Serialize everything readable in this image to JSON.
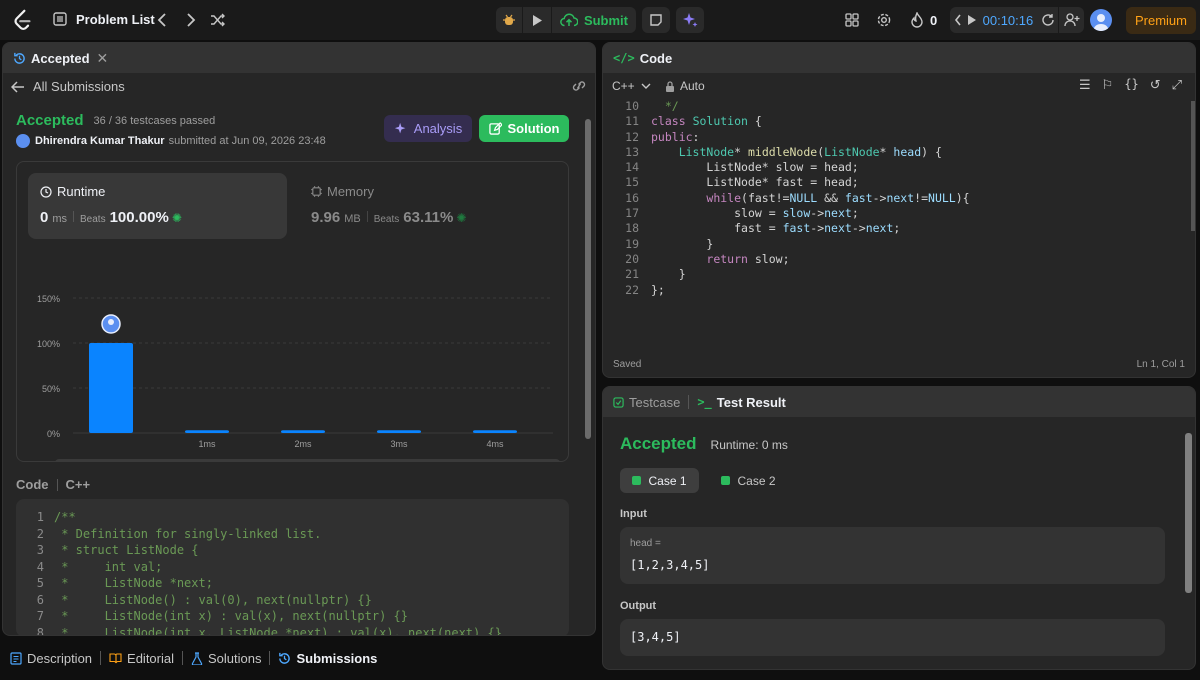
{
  "topbar": {
    "problem_list": "Problem List",
    "submit": "Submit",
    "streak": "0",
    "timer": "00:10:16",
    "premium": "Premium"
  },
  "left_panel": {
    "tab_title": "Accepted",
    "back_label": "All Submissions",
    "status": "Accepted",
    "testcases": "36 / 36 testcases passed",
    "user": "Dhirendra Kumar Thakur",
    "submitted_at": "submitted at Jun 09, 2026 23:48",
    "analysis_label": "Analysis",
    "solution_label": "Solution",
    "runtime": {
      "label": "Runtime",
      "value": "0",
      "unit": "ms",
      "beats_label": "Beats",
      "beats": "100.00%"
    },
    "memory": {
      "label": "Memory",
      "value": "9.96",
      "unit": "MB",
      "beats_label": "Beats",
      "beats": "63.11%"
    },
    "code_label": "Code",
    "code_lang": "C++",
    "code_lines": [
      {
        "n": "1",
        "t": "/**"
      },
      {
        "n": "2",
        "t": " * Definition for singly-linked list."
      },
      {
        "n": "3",
        "t": " * struct ListNode {"
      },
      {
        "n": "4",
        "t": " *     int val;"
      },
      {
        "n": "5",
        "t": " *     ListNode *next;"
      },
      {
        "n": "6",
        "t": " *     ListNode() : val(0), next(nullptr) {}"
      },
      {
        "n": "7",
        "t": " *     ListNode(int x) : val(x), next(nullptr) {}"
      },
      {
        "n": "8",
        "t": " *     ListNode(int x, ListNode *next) : val(x), next(next) {}"
      }
    ]
  },
  "chart_data": {
    "type": "bar",
    "categories": [
      "",
      "1ms",
      "2ms",
      "3ms",
      "4ms"
    ],
    "values": [
      100,
      3,
      3,
      3,
      3
    ],
    "ylim": [
      0,
      150
    ],
    "yticks": [
      "150%",
      "100%",
      "50%",
      "0%"
    ],
    "minimap_labels": [
      "1ms",
      "2ms",
      "3ms",
      "4ms"
    ],
    "bar_color": "#0a84ff"
  },
  "bottom_tabs": {
    "description": "Description",
    "editorial": "Editorial",
    "solutions": "Solutions",
    "submissions": "Submissions"
  },
  "editor": {
    "title": "Code",
    "lang": "C++",
    "mode": "Auto",
    "saved": "Saved",
    "position": "Ln 1, Col 1"
  },
  "test_panel": {
    "tab_testcase": "Testcase",
    "tab_result": "Test Result",
    "status": "Accepted",
    "runtime": "Runtime: 0 ms",
    "case1": "Case 1",
    "case2": "Case 2",
    "input_label": "Input",
    "input_var": "head =",
    "input_value": "[1,2,3,4,5]",
    "output_label": "Output",
    "output_value": "[3,4,5]"
  },
  "colors": {
    "accent_green": "#2cbb5d",
    "premium": "#ffa116",
    "blue": "#0a84ff"
  }
}
